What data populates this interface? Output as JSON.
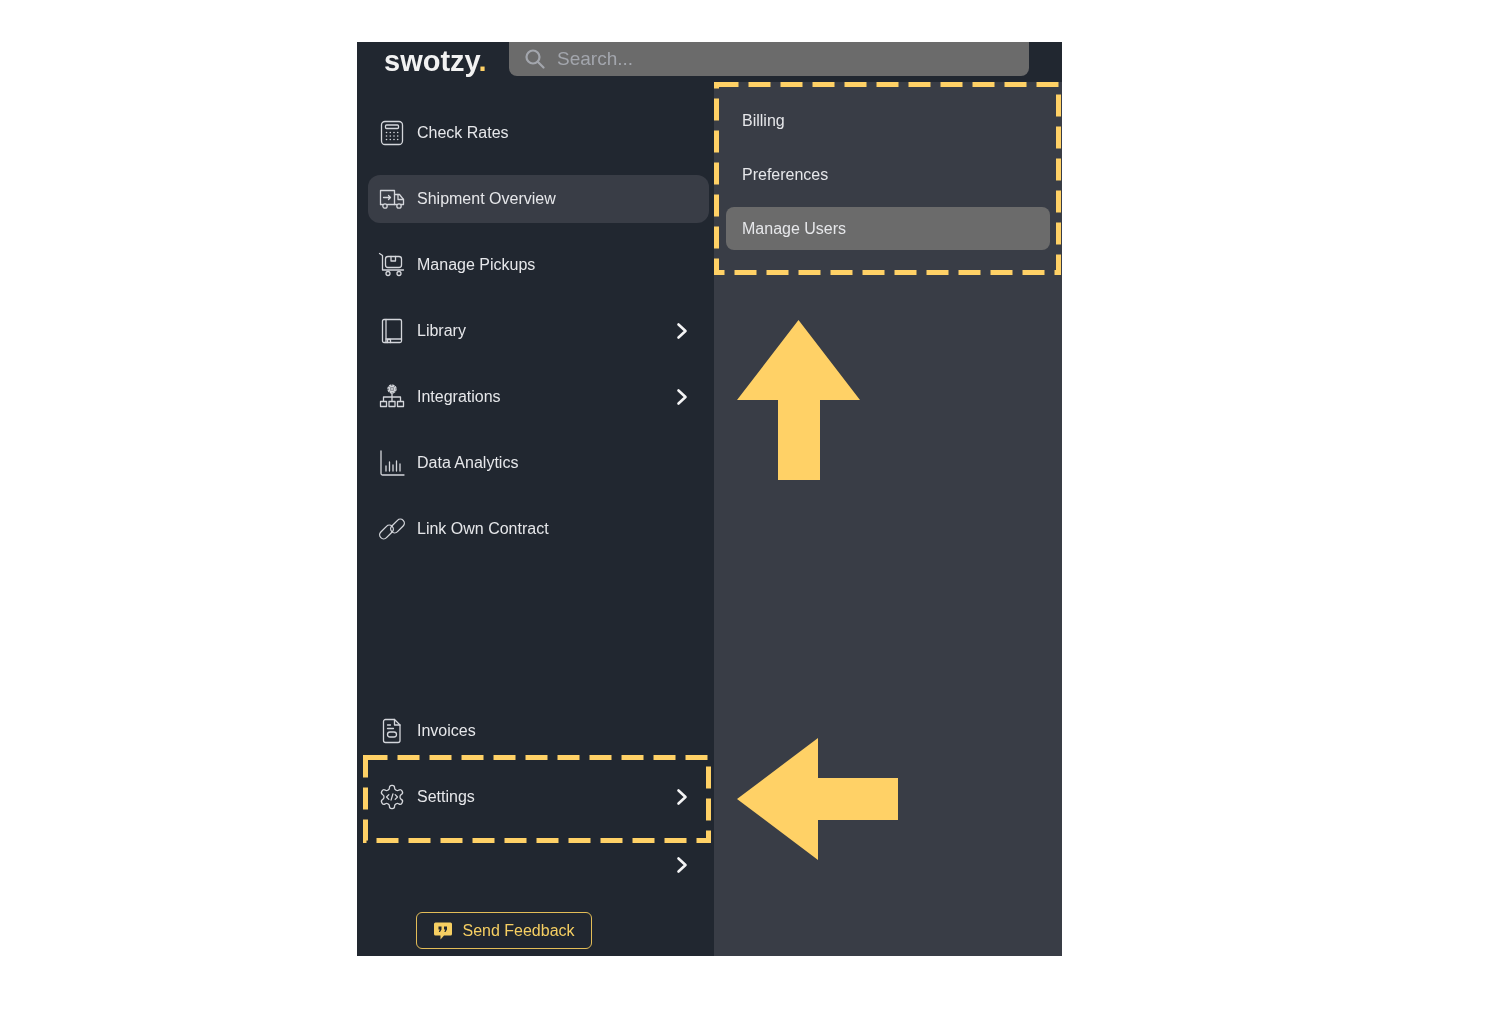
{
  "header": {
    "logo": {
      "name": "swotzy",
      "mark": "."
    },
    "search": {
      "placeholder": "Search..."
    }
  },
  "sidebar": {
    "items": [
      {
        "label": "Check Rates",
        "selected": false,
        "has_submenu": false,
        "highlighted": false
      },
      {
        "label": "Shipment Overview",
        "selected": true,
        "has_submenu": false,
        "highlighted": false
      },
      {
        "label": "Manage Pickups",
        "selected": false,
        "has_submenu": false,
        "highlighted": false
      },
      {
        "label": "Library",
        "selected": false,
        "has_submenu": true,
        "highlighted": false
      },
      {
        "label": "Integrations",
        "selected": false,
        "has_submenu": true,
        "highlighted": false
      },
      {
        "label": "Data Analytics",
        "selected": false,
        "has_submenu": false,
        "highlighted": false
      },
      {
        "label": "Link Own Contract",
        "selected": false,
        "has_submenu": false,
        "highlighted": false
      }
    ],
    "bottom_items": [
      {
        "label": "Invoices",
        "selected": false,
        "has_submenu": false,
        "highlighted": false
      },
      {
        "label": "Settings",
        "selected": false,
        "has_submenu": true,
        "highlighted": true
      }
    ],
    "feedback_button": {
      "label": "Send Feedback"
    }
  },
  "submenu": {
    "highlighted": true,
    "items": [
      {
        "label": "Billing",
        "selected": false
      },
      {
        "label": "Preferences",
        "selected": false
      },
      {
        "label": "Manage Users",
        "selected": true
      }
    ]
  },
  "annotations": [
    {
      "kind": "arrow-up"
    },
    {
      "kind": "arrow-left"
    }
  ]
}
